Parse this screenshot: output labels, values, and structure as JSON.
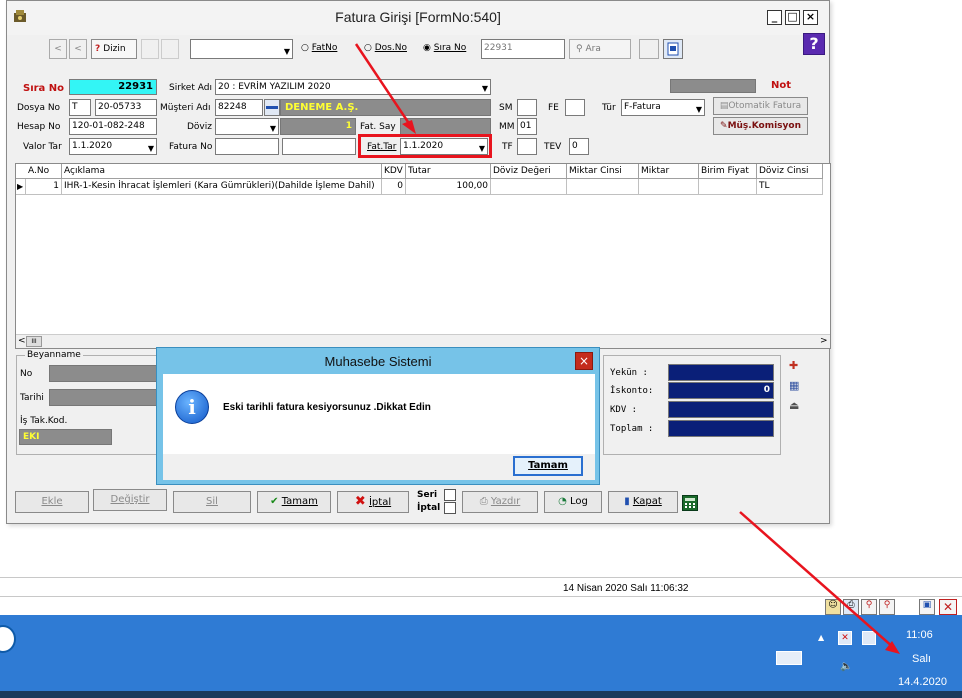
{
  "window": {
    "title": "Fatura Girişi [FormNo:540]",
    "controls": {
      "minimize": "_",
      "maximize": "□",
      "close": "×"
    }
  },
  "toolbar": {
    "dizin_label": "Dizin",
    "search_options": [
      "FatNo",
      "Dos.No",
      "Sıra No"
    ],
    "selected_search": "Sıra No",
    "search_value": "22931",
    "ara_label": "Ara"
  },
  "header": {
    "sira_no_label": "Sıra No",
    "sira_no_value": "22931",
    "sirket_adi_label": "Sirket Adı",
    "sirket_adi_value": "20 : EVRİM YAZILIM 2020",
    "dosya_no_label": "Dosya No",
    "dosya_no_prefix": "T",
    "dosya_no_value": "20-05733",
    "musteri_adi_label": "Müşteri Adı",
    "musteri_code": "82248",
    "musteri_name": "DENEME A.Ş.",
    "hesap_no_label": "Hesap No",
    "hesap_no_value": "120-01-082-248",
    "doviz_label": "Döviz",
    "doviz_rate": "1",
    "fat_say_label": "Fat. Say",
    "valor_tar_label": "Valor Tar",
    "valor_tar_value": "1.1.2020",
    "fatura_no_label": "Fatura No",
    "fat_tar_label": "Fat.Tar",
    "fat_tar_value": "1.1.2020",
    "sm_label": "SM",
    "fe_label": "FE",
    "mm_label": "MM",
    "mm_value": "01",
    "tf_label": "TF",
    "tev_label": "TEV",
    "tev_value": "0",
    "tur_label": "Tür",
    "tur_value": "F-Fatura",
    "not_label": "Not",
    "otomatik_fatura_label": "Otomatik Fatura",
    "mus_komisyon_label": "Müş.Komisyon"
  },
  "grid": {
    "columns": [
      "A.No",
      "Açıklama",
      "KDV",
      "Tutar",
      "Döviz Değeri",
      "Miktar Cinsi",
      "Miktar",
      "Birim Fiyat",
      "Döviz Cinsi"
    ],
    "rows": [
      {
        "ano": "1",
        "aciklama": "IHR-1-Kesin İhracat İşlemleri (Kara Gümrükleri)(Dahilde İşleme Dahil)",
        "kdv": "0",
        "tutar": "100,00",
        "doviz_degeri": "",
        "miktar_cinsi": "",
        "miktar": "",
        "birim_fiyat": "",
        "doviz_cinsi": "TL"
      }
    ],
    "scroll_left": "<",
    "scroll_right": ">",
    "scroll_thumb": "III"
  },
  "beyanname": {
    "title": "Beyanname",
    "no_label": "No",
    "tarihi_label": "Tarihi",
    "is_tak_kod_label": "İş Tak.Kod.",
    "is_tak_kod_value": "EKI"
  },
  "totals": {
    "yekun_label": "Yekün  :",
    "iskonto_label": "İskonto:",
    "iskonto_value": "0",
    "kdv_label": "KDV    :",
    "toplam_label": "Toplam :"
  },
  "buttons": {
    "ekle": "Ekle",
    "degistir": "Değiştir",
    "sil": "Sil",
    "tamam": "Tamam",
    "iptal": "İptal",
    "seri_label": "Seri",
    "iptal_check_label": "İptal",
    "yazdir": "Yazdır",
    "log": "Log",
    "kapat": "Kapat"
  },
  "dialog": {
    "title": "Muhasebe Sistemi",
    "message": "Eski tarihli fatura kesiyorsunuz .Dikkat Edin",
    "ok_label": "Tamam",
    "close": "×"
  },
  "status_bar": {
    "datetime": "14 Nisan 2020 Salı 11:06:32"
  },
  "taskbar": {
    "time": "11:06",
    "day": "Salı",
    "date": "14.4.2020"
  },
  "colors": {
    "accent_cyan": "#33f5f5",
    "musteri_gray": "#8c8c8c",
    "musteri_text": "#ffff33",
    "totals_navy": "#0a1f78",
    "dialog_blue": "#76c3e8",
    "annotation_red": "#e8141e",
    "taskbar_blue": "#2f7bd4"
  }
}
